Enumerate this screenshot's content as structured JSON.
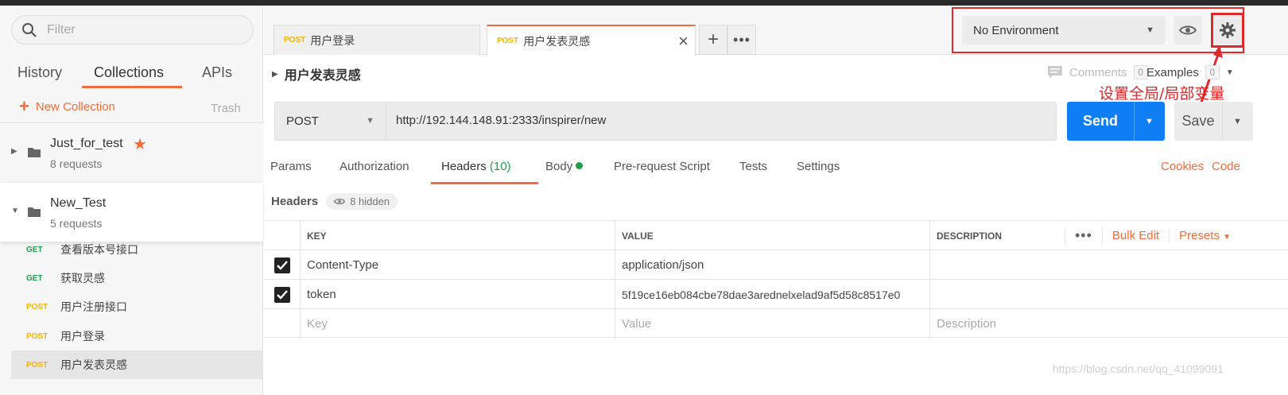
{
  "sidebar": {
    "filter_placeholder": "Filter",
    "tabs": [
      "History",
      "Collections",
      "APIs"
    ],
    "new_collection": "New Collection",
    "trash": "Trash",
    "collections": [
      {
        "name": "Just_for_test",
        "count": "8 requests"
      },
      {
        "name": "New_Test",
        "count": "5 requests"
      }
    ],
    "requests": [
      {
        "method": "GET",
        "name": "查看版本号接口"
      },
      {
        "method": "GET",
        "name": "获取灵感"
      },
      {
        "method": "POST",
        "name": "用户注册接口"
      },
      {
        "method": "POST",
        "name": "用户登录"
      },
      {
        "method": "POST",
        "name": "用户发表灵感"
      }
    ]
  },
  "tabs": [
    {
      "method": "POST",
      "name": "用户登录"
    },
    {
      "method": "POST",
      "name": "用户发表灵感"
    }
  ],
  "environment": {
    "selected": "No Environment"
  },
  "annotation": "设置全局/局部变量",
  "request": {
    "title": "用户发表灵感",
    "comments_label": "Comments",
    "comments_count": "0",
    "examples_label": "Examples",
    "examples_count": "0",
    "method": "POST",
    "url": "http://192.144.148.91:2333/inspirer/new",
    "send": "Send",
    "save": "Save"
  },
  "request_tabs": {
    "params": "Params",
    "authorization": "Authorization",
    "headers": "Headers",
    "headers_count": "(10)",
    "body": "Body",
    "prerequest": "Pre-request Script",
    "tests": "Tests",
    "settings": "Settings",
    "cookies": "Cookies",
    "code": "Code"
  },
  "headers": {
    "label": "Headers",
    "hidden": "8 hidden",
    "columns": {
      "key": "KEY",
      "value": "VALUE",
      "description": "DESCRIPTION"
    },
    "bulk_edit": "Bulk Edit",
    "presets": "Presets",
    "rows": [
      {
        "key": "Content-Type",
        "value": "application/json"
      },
      {
        "key": "token",
        "value": "5f19ce16eb084cbe78dae3arednelxelad9af5d58c8517e0"
      }
    ],
    "placeholders": {
      "key": "Key",
      "value": "Value",
      "description": "Description"
    }
  },
  "watermark": "https://blog.csdn.net/qq_41099091",
  "colors": {
    "accent": "#f26b3a",
    "send": "#0f7ef4",
    "annotation": "#e0282b"
  }
}
